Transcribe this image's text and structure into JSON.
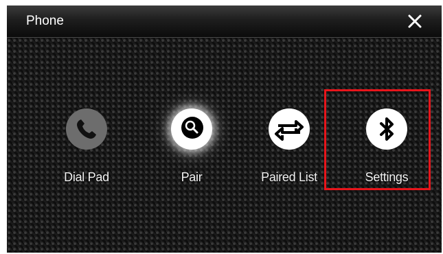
{
  "header": {
    "title": "Phone"
  },
  "tiles": [
    {
      "label": "Dial Pad"
    },
    {
      "label": "Pair"
    },
    {
      "label": "Paired List"
    },
    {
      "label": "Settings"
    }
  ],
  "colors": {
    "highlight": "#e8151b",
    "icon_gray": "#6d6d6d",
    "icon_white": "#ffffff"
  },
  "icons": [
    "phone-icon",
    "search-icon",
    "swap-arrows-icon",
    "bluetooth-icon",
    "close-icon"
  ]
}
